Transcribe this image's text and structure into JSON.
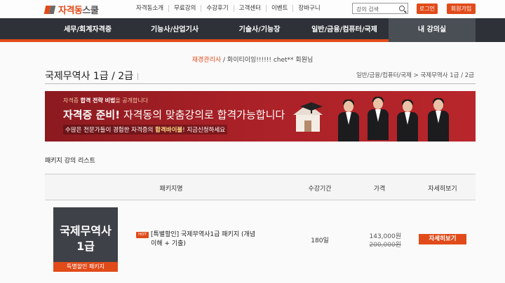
{
  "header": {
    "logo_main": "자격동",
    "logo_sub": "스쿨",
    "nav": [
      "자격동소개",
      "무료강의",
      "수강후기",
      "고객센터",
      "이벤트",
      "장바구니"
    ],
    "search_placeholder": "강의 검색",
    "login": "로그인",
    "join": "회원가입"
  },
  "main_nav": [
    "세무/회계자격증",
    "기능사/산업기사",
    "기술사/기능장",
    "일반/금융/컴퓨터/국제",
    "내 강의실"
  ],
  "welcome": {
    "role": "재경관리사",
    "slogan": "/ 화이티이잉!!!!!!",
    "user": "chet** 회원님"
  },
  "page": {
    "title": "국제무역사 1급 / 2급",
    "breadcrumb": "일반/금융/컴퓨터/국제 > 국제무역사 1급 / 2급"
  },
  "banner": {
    "line1_pre": "자격증 ",
    "line1_bold": "합격 전략 비법",
    "line1_post": "을 공개합니다",
    "line2_bold": "자격증 준비!",
    "line2_rest": " 자격동의 맞춤강의로 합격가능합니다",
    "line3_pre": "수많은 전문가들이 경험한 자격증의 ",
    "line3_bold": "합격바이블",
    "line3_post": "! 지금신청하세요"
  },
  "package_list": {
    "section_title": "패키지 강의 리스트",
    "headers": {
      "name": "패키지명",
      "period": "수강기간",
      "price": "가격",
      "detail": "자세히보기"
    },
    "rows": [
      {
        "thumb_line1": "국제무역사",
        "thumb_line2": "1급",
        "thumb_tag": "특별할인 패키지",
        "badge": "HOT",
        "name": "[특별할인] 국제무역사1급 패키지 (개념이해 + 기출)",
        "period": "180일",
        "price": "143,000원",
        "original_price": "200,000원",
        "detail_label": "자세히보기"
      }
    ]
  },
  "colors": {
    "accent": "#e14b1a",
    "nav_bg": "#2e3238",
    "banner_bg": "#a92127"
  }
}
